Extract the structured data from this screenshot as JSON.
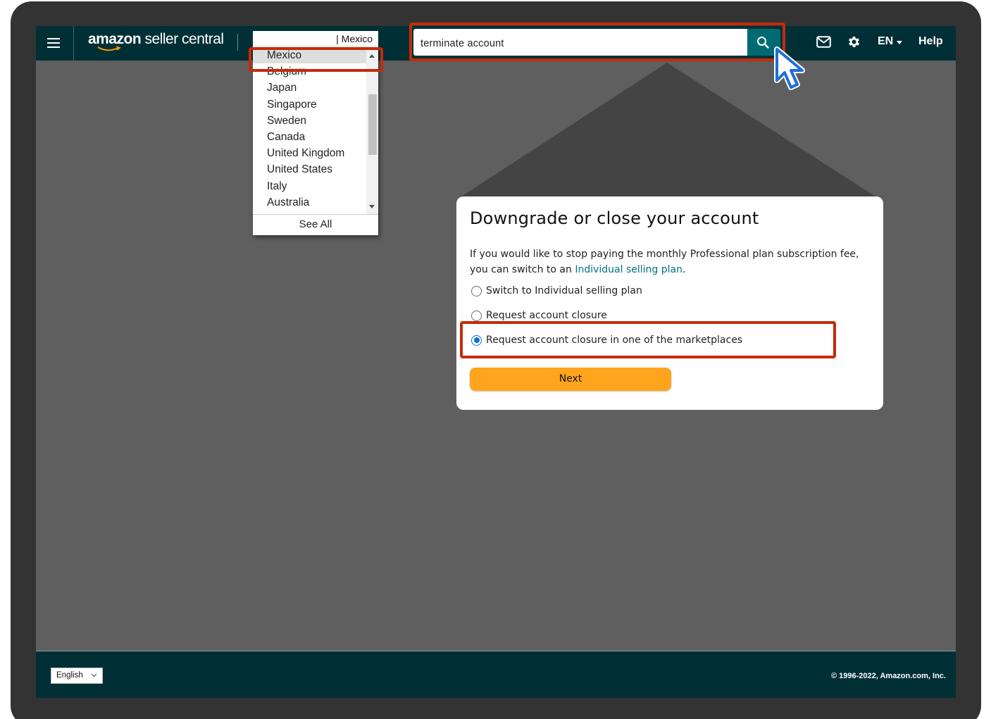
{
  "nav": {
    "logo_brand": "amazon",
    "logo_product": " seller central",
    "marketplace_current": "| Mexico",
    "search_value": "terminate account",
    "language": "EN",
    "help": "Help",
    "icons": [
      "menu-icon",
      "search-icon",
      "mail-icon",
      "gear-icon"
    ]
  },
  "marketplace_dropdown": {
    "items": [
      "Mexico",
      "Belgium",
      "Japan",
      "Singapore",
      "Sweden",
      "Canada",
      "United Kingdom",
      "United States",
      "Italy",
      "Australia"
    ],
    "selected": "Mexico",
    "see_all": "See All"
  },
  "modal": {
    "title": "Downgrade or close your account",
    "desc_line1": "If you would like to stop paying the monthly Professional plan subscription fee,",
    "desc_line2_prefix": "you can switch to an ",
    "desc_link": "Individual selling plan",
    "desc_line2_suffix": ".",
    "options": [
      {
        "label": "Switch to Individual selling plan",
        "checked": false
      },
      {
        "label": "Request account closure",
        "checked": false
      },
      {
        "label": "Request account closure in one of the marketplaces",
        "checked": true
      }
    ],
    "next_label": "Next"
  },
  "footer": {
    "language": "English",
    "copyright": "© 1996-2022, Amazon.com, Inc."
  },
  "colors": {
    "nav_bg": "#002f36",
    "search_button": "#006a73",
    "highlight": "#c42b0b",
    "next_button": "#ffa41c",
    "link": "#007185",
    "cursor": "#1c6fd8"
  }
}
